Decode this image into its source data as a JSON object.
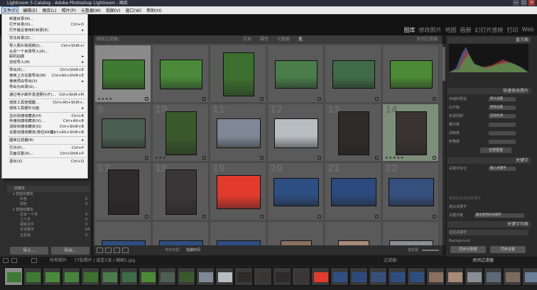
{
  "window": {
    "title": "Lightroom 5 Catalog - Adobe Photoshop Lightroom - 图库",
    "controls": [
      "—",
      "□",
      "✕"
    ]
  },
  "menubar": [
    "文件(F)",
    "编辑(E)",
    "图库(L)",
    "照片(P)",
    "元数据(M)",
    "视图(V)",
    "窗口(W)",
    "帮助(H)"
  ],
  "modules": [
    "图库",
    "修改照片",
    "地图",
    "画册",
    "幻灯片放映",
    "打印",
    "Web"
  ],
  "file_menu": [
    {
      "label": "新建目录(N)...",
      "shortcut": ""
    },
    {
      "label": "打开目录(O)...",
      "shortcut": "Ctrl+O"
    },
    {
      "label": "打开最近使用的目录(E)",
      "shortcut": "",
      "submenu": true
    },
    {
      "sep": true
    },
    {
      "label": "优化目录(Z)...",
      "shortcut": ""
    },
    {
      "sep": true
    },
    {
      "label": "导入照片和视频(I)...",
      "shortcut": "Ctrl+Shift+I"
    },
    {
      "label": "从另一个目录导入(A)...",
      "shortcut": ""
    },
    {
      "label": "联机拍摄",
      "shortcut": "",
      "submenu": true
    },
    {
      "label": "自动导入(A)",
      "shortcut": "",
      "submenu": true
    },
    {
      "sep": true
    },
    {
      "label": "导出(E)...",
      "shortcut": "Ctrl+Shift+E"
    },
    {
      "label": "使用上次设置导出(W)",
      "shortcut": "Ctrl+Alt+Shift+E"
    },
    {
      "label": "使用预设导出(X)",
      "shortcut": "",
      "submenu": true
    },
    {
      "label": "导出为目录(G)...",
      "shortcut": ""
    },
    {
      "sep": true
    },
    {
      "label": "通过电子邮件发送照片(F)...",
      "shortcut": "Ctrl+Shift+M"
    },
    {
      "sep": true
    },
    {
      "label": "增效工具管理器...",
      "shortcut": "Ctrl+Alt+Shift+,"
    },
    {
      "label": "增效工具额外功能",
      "shortcut": "",
      "submenu": true
    },
    {
      "sep": true
    },
    {
      "label": "显示快捷收藏夹(H)",
      "shortcut": "Ctrl+B"
    },
    {
      "label": "存储快捷收藏夹(V)...",
      "shortcut": "Ctrl+Alt+B"
    },
    {
      "label": "清除快捷收藏夹(Q)",
      "shortcut": "Ctrl+Shift+B"
    },
    {
      "label": "设置快捷收藏夹(按住Alt键)",
      "shortcut": "Ctrl+Alt+Shift+B"
    },
    {
      "sep": true
    },
    {
      "label": "图库过滤器(R)",
      "shortcut": "",
      "submenu": true
    },
    {
      "sep": true
    },
    {
      "label": "打印(P)...",
      "shortcut": "Ctrl+P"
    },
    {
      "label": "页面设置(A)...",
      "shortcut": "Ctrl+Shift+P"
    },
    {
      "sep": true
    },
    {
      "label": "退出(X)",
      "shortcut": "Ctrl+Q"
    }
  ],
  "left_panel": {
    "collections_header": "收藏夹",
    "tree": [
      {
        "label": "▾ 智能收藏夹",
        "count": ""
      },
      {
        "label": "红色",
        "count": "0"
      },
      {
        "label": "绿色",
        "count": "0"
      },
      {
        "label": "▾ 智能收藏夹",
        "count": ""
      },
      {
        "label": "过去一个月",
        "count": "0"
      },
      {
        "label": "上个月",
        "count": "0"
      },
      {
        "label": "视频文件",
        "count": "0"
      },
      {
        "label": "无关键字",
        "count": "64"
      },
      {
        "label": "五星级",
        "count": "0"
      }
    ],
    "import_label": "导入...",
    "export_label": "导出..."
  },
  "filter_bar": {
    "label": "图库过滤器：",
    "options": [
      "文本",
      "属性",
      "元数据",
      "无"
    ],
    "selected": "无",
    "right": "关闭过滤器"
  },
  "grid": {
    "cells": [
      {
        "num": "",
        "color": "#3f7a32",
        "w": 60,
        "h": 42,
        "stars": "★★★★",
        "sel": true
      },
      {
        "num": "",
        "color": "#4a8a3a",
        "w": 60,
        "h": 42,
        "stars": ""
      },
      {
        "num": "",
        "color": "#3d6f2e",
        "w": 44,
        "h": 62,
        "stars": ""
      },
      {
        "num": "",
        "color": "#4b7d4a",
        "w": 60,
        "h": 40,
        "stars": ""
      },
      {
        "num": "",
        "color": "#406b48",
        "w": 60,
        "h": 40,
        "stars": ""
      },
      {
        "num": "",
        "color": "#4c8a35",
        "w": 60,
        "h": 40,
        "stars": ""
      },
      {
        "num": "9",
        "color": "#4d5f52",
        "w": 62,
        "h": 42,
        "stars": ""
      },
      {
        "num": "10",
        "color": "#3b5a2c",
        "w": 44,
        "h": 62,
        "stars": "★★★"
      },
      {
        "num": "11",
        "color": "#7e8896",
        "w": 62,
        "h": 42,
        "stars": ""
      },
      {
        "num": "12",
        "color": "#b8bdc2",
        "w": 62,
        "h": 42,
        "stars": ""
      },
      {
        "num": "13",
        "color": "#2f2b2a",
        "w": 44,
        "h": 62,
        "stars": ""
      },
      {
        "num": "14",
        "color": "#3a3533",
        "w": 44,
        "h": 62,
        "stars": "★★★★★",
        "hl": true
      },
      {
        "num": "17",
        "color": "#2d2a2c",
        "w": 44,
        "h": 64,
        "stars": ""
      },
      {
        "num": "18",
        "color": "#3a3638",
        "w": 44,
        "h": 64,
        "stars": ""
      },
      {
        "num": "19",
        "color": "#e23b2e",
        "w": 62,
        "h": 48,
        "stars": ""
      },
      {
        "num": "20",
        "color": "#2e4f82",
        "w": 64,
        "h": 40,
        "stars": ""
      },
      {
        "num": "21",
        "color": "#2c4a7e",
        "w": 64,
        "h": 40,
        "stars": ""
      },
      {
        "num": "22",
        "color": "#36507e",
        "w": 64,
        "h": 40,
        "stars": ""
      },
      {
        "num": "",
        "color": "#2f4e80",
        "w": 62,
        "h": 30,
        "stars": ""
      },
      {
        "num": "",
        "color": "#2f4e80",
        "w": 62,
        "h": 30,
        "stars": ""
      },
      {
        "num": "",
        "color": "#2f4e80",
        "w": 62,
        "h": 30,
        "stars": ""
      },
      {
        "num": "",
        "color": "#8a7060",
        "w": 44,
        "h": 30,
        "stars": ""
      },
      {
        "num": "",
        "color": "#a88a78",
        "w": 44,
        "h": 30,
        "stars": ""
      },
      {
        "num": "",
        "color": "#8a8f95",
        "w": 62,
        "h": 30,
        "stars": ""
      }
    ]
  },
  "toolbar": {
    "sort_label": "排序依据：",
    "sort_value": "拍摄时间",
    "thumb_label": "缩览图"
  },
  "right_panel": {
    "histogram_label": "直方图",
    "quick_develop": "快速修改照片",
    "rows": [
      {
        "label": "存储的预设",
        "value": "默认设置"
      },
      {
        "label": "白平衡",
        "value": "原照设置"
      },
      {
        "label": "色调控制",
        "value": "自动色调"
      },
      {
        "label": "曝光度",
        "value": ""
      },
      {
        "label": "清晰度",
        "value": ""
      },
      {
        "label": "鲜艳度",
        "value": ""
      }
    ],
    "reset_label": "全部重置",
    "keywording": "关键字",
    "keyword_tags_label": "关键字标记",
    "keyword_tags_value": "输入关键字",
    "keyword_hint": "单击此处添加关键字",
    "suggestions": "建议关键字",
    "keyword_set_label": "关键字集",
    "keyword_set_value": "最近使用的关键字",
    "keyword_list": "关键字列表",
    "filter_keywords": "过滤关键字",
    "keyword_item": "Background",
    "sync_meta": "同步元数据",
    "sync_settings": "同步设置"
  },
  "filmstrip_bar": {
    "source": "所有照片",
    "count": "77张照片 / 选定1张 / 缩纲1.jpg",
    "filter": "过滤器：",
    "filter_value": "关闭过滤器"
  },
  "filmstrip_colors": [
    "#3d7a33",
    "#3d7a33",
    "#4a8a3a",
    "#46843c",
    "#3d6f2e",
    "#4b7d4a",
    "#406b48",
    "#4c8a35",
    "#4d5f52",
    "#3b5a2c",
    "#7e8896",
    "#b8bdc2",
    "#2f2b2a",
    "#3a3533",
    "#2d2a2c",
    "#3a3638",
    "#e23b2e",
    "#2e4f82",
    "#2c4a7e",
    "#36507e",
    "#2f4e80",
    "#2f4e80",
    "#8a7060",
    "#a88a78",
    "#8a8f95",
    "#5e6a78",
    "#7a6a60",
    "#6b7f9a"
  ]
}
